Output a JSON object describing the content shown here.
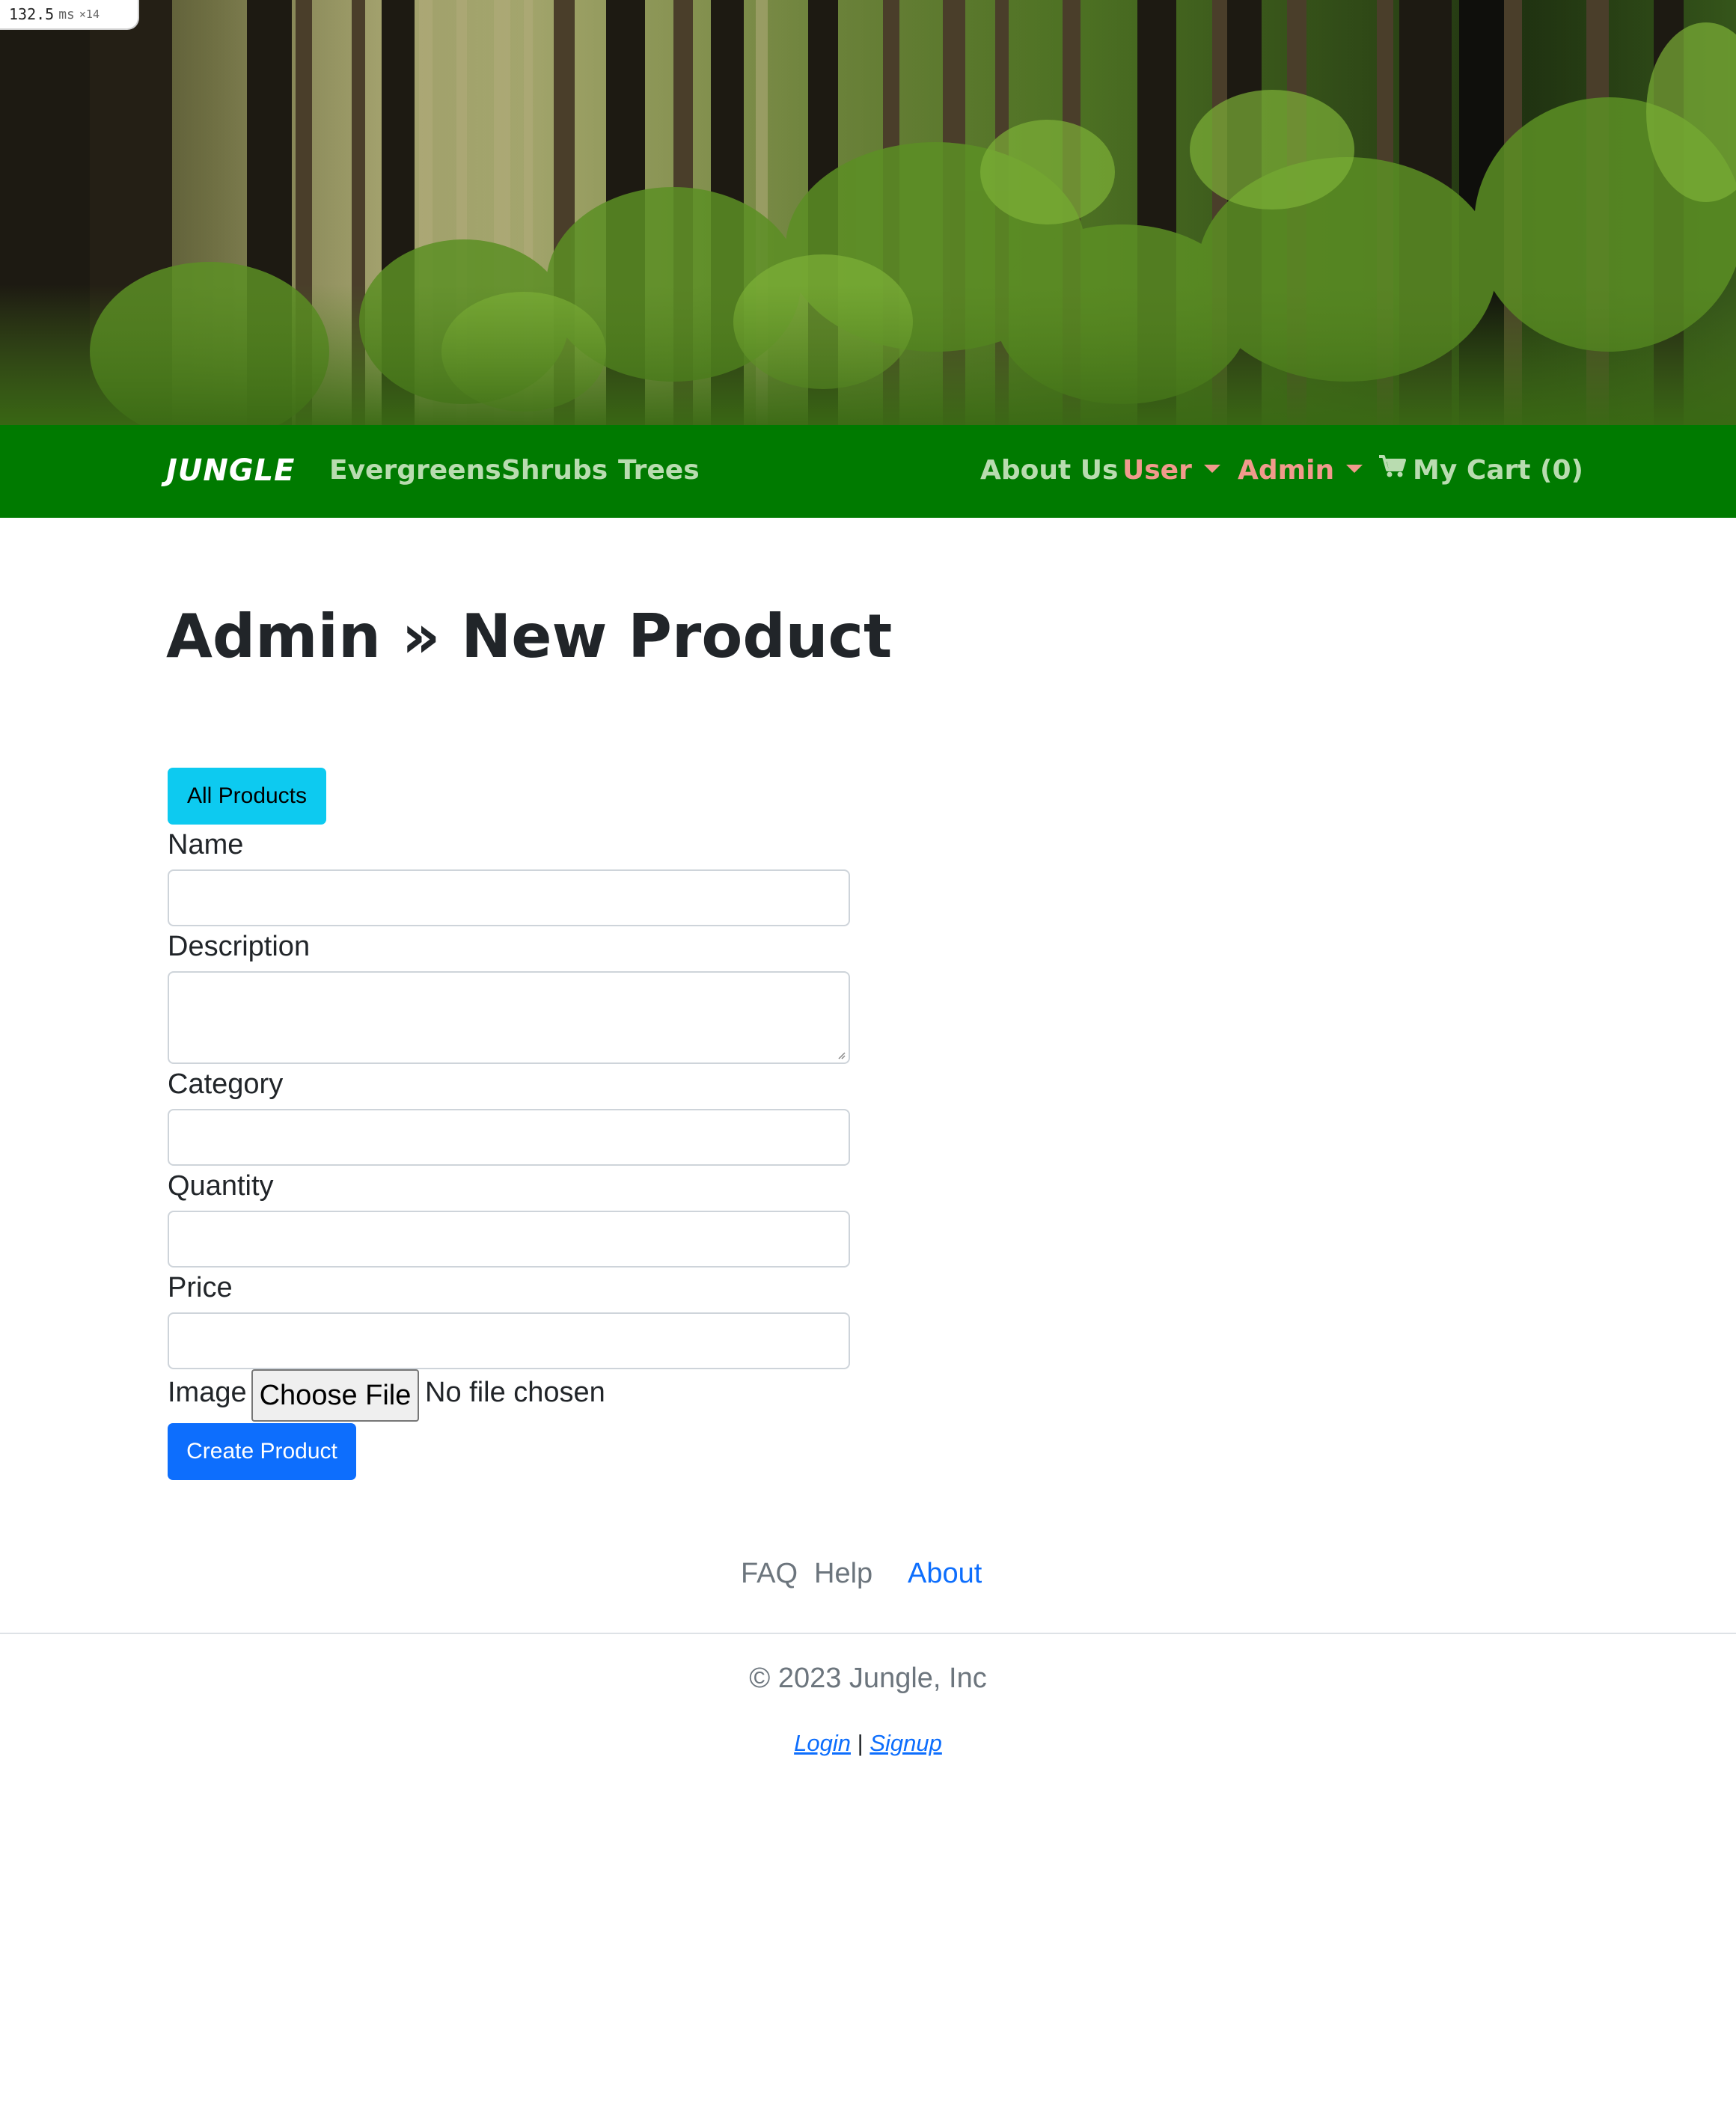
{
  "perf": {
    "value": "132.5",
    "unit": "ms",
    "multiplier": "×14"
  },
  "navbar": {
    "brand": "JUNGLE",
    "left_links": [
      "Evergreens",
      "Shrubs",
      "Trees"
    ],
    "about": "About Us",
    "user": "User",
    "admin": "Admin",
    "cart": "My Cart (0)",
    "background": "#007a00",
    "link_color": "#b9dcb0",
    "dropdown_color": "#f19a8c"
  },
  "page": {
    "title": "Admin » New Product",
    "all_products_button": "All Products"
  },
  "form": {
    "name_label": "Name",
    "description_label": "Description",
    "category_label": "Category",
    "quantity_label": "Quantity",
    "price_label": "Price",
    "image_label": "Image",
    "choose_file": "Choose File",
    "file_status": "No file chosen",
    "submit": "Create Product"
  },
  "footer": {
    "links": [
      "FAQ",
      "Help",
      "About"
    ],
    "active_link": "About",
    "copyright": "© 2023 Jungle, Inc",
    "login": "Login",
    "separator": "|",
    "signup": "Signup"
  },
  "colors": {
    "info_button": "#0dcaf0",
    "primary_button": "#0d6efd"
  }
}
